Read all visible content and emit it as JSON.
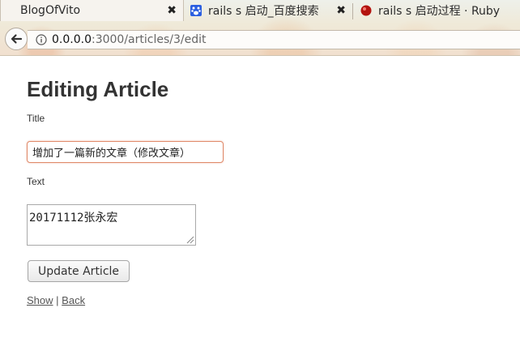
{
  "browser": {
    "tabs": [
      {
        "title": "BlogOfVito",
        "active": true,
        "icon": "none"
      },
      {
        "title": "rails s 启动_百度搜索",
        "active": false,
        "icon": "baidu-paw-icon"
      },
      {
        "title": "rails s 启动过程 · Ruby",
        "active": false,
        "icon": "ruby-icon"
      }
    ],
    "close_glyph": "✖",
    "url": {
      "host": "0.0.0.0",
      "path": ":3000/articles/3/edit"
    }
  },
  "page": {
    "heading": "Editing Article",
    "title_label": "Title",
    "title_value": "增加了一篇新的文章（修改文章）",
    "text_label": "Text",
    "text_value": "20171112张永宏",
    "submit_label": "Update Article",
    "show_link": "Show",
    "separator": "|",
    "back_link": "Back"
  },
  "colors": {
    "input_focus_border": "#e08a6a",
    "link": "#555555",
    "heading": "#333333"
  }
}
